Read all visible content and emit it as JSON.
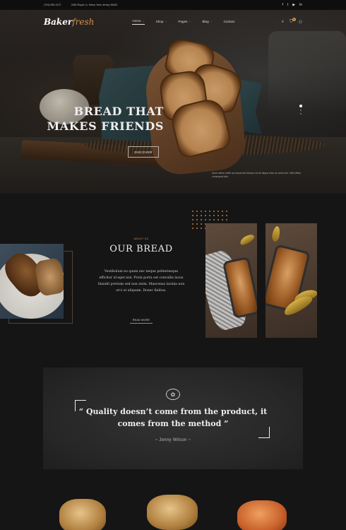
{
  "topbar": {
    "phone": "(704) 555-0127",
    "address": "2464 Royal Ln. Mesa, New Jersey 45463",
    "social": [
      "f",
      "t",
      "▶",
      "in"
    ],
    "social_names": [
      "facebook-icon",
      "twitter-icon",
      "youtube-icon",
      "linkedin-icon"
    ]
  },
  "nav": {
    "logo_a": "Baker",
    "logo_b": "fresh",
    "items": [
      {
        "label": "Home",
        "caret": "⌄"
      },
      {
        "label": "Shop",
        "caret": "⌄"
      },
      {
        "label": "Pages",
        "caret": "⌄"
      },
      {
        "label": "Blog",
        "caret": "⌄"
      },
      {
        "label": "Contact",
        "caret": ""
      }
    ],
    "icons": {
      "search": "⌕",
      "cart": "⛉",
      "user": "⚇"
    },
    "cart_count": "0"
  },
  "hero": {
    "title": "BREAD THAT MAKES FRIENDS",
    "button": "DISCOVER",
    "description": "Amet minim mollit non deserunt ullamco est sit aliqua dolor do amet sint. Velit officia consequat duis."
  },
  "bread": {
    "kicker": "ABOUT US",
    "title": "OUR BREAD",
    "text": "Vestibulum eu quam nec neque pellentesque efficitur id eget nisl. Proin porta est convallis lacus blandit pretium sed non enim. Maecenas lacinia non orci at aliquam. Donec finibus.",
    "button": "READ MORE"
  },
  "quote": {
    "icon": "✿",
    "text": "“ Quality doesn’t come from the product, it comes from the method ”",
    "author": "~  Jenny Wilson  ~"
  },
  "colors": {
    "accent": "#d4924b",
    "background": "#151515"
  }
}
